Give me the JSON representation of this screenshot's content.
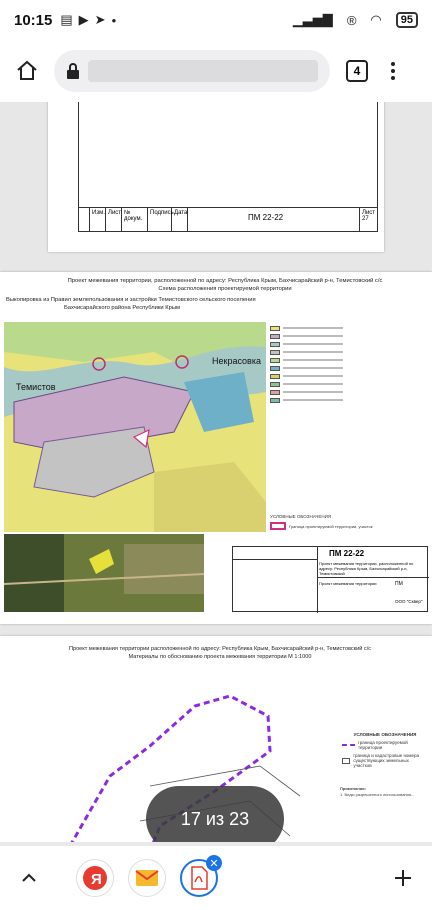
{
  "status_bar": {
    "time": "10:15",
    "battery": "95"
  },
  "toolbar": {
    "tab_count": "4"
  },
  "pdf": {
    "page1": {
      "code": "ПМ 22-22",
      "stamp_labels": [
        "Изм.",
        "Лист",
        "№ докум.",
        "Подпись",
        "Дата"
      ],
      "sheet_label": "Лист",
      "sheet_no": "27"
    },
    "page2": {
      "title": "Проект межевания территории, расположенной по адресу: Республика Крым, Бахчисарайский р-н, Темистовский с/с",
      "subtitle": "Схема расположения проектируемой территории",
      "extract": "Выкопировка из Правил землепользования и застройки Темистовского сельского поселения",
      "extract2": "Бахчисарайского района Республики Крым",
      "map_labels": [
        "Темистов",
        "Некрасовка"
      ],
      "legend_title": "УСЛОВНЫЕ ОБОЗНАЧЕНИЯ",
      "legend_item": "Граница проектируемой территории, участок",
      "stamp_code": "ПМ 22-22",
      "stamp_text": "Проект межевания территории, расположенной по адресу: Республика Крым, Бахчисарайский р-н, Темистовский",
      "stamp_sheet": "Проект межевания территории",
      "stamp_stage": "ПМ",
      "stamp_company": "ООО \"Сквер\""
    },
    "page3": {
      "title": "Проект межевания территории расположенной по адресу: Республика Крым, Бахчисарайский р-н, Темистовский с/с",
      "subtitle": "Материалы по обоснованию проекта межевания территории М 1:1000",
      "legend_title": "УСЛОВНЫЕ ОБОЗНАЧЕНИЯ",
      "legend1": "граница проектируемой территории",
      "legend2": "граница и кадастровые номера существующих земельных участков",
      "notes_title": "Примечания:",
      "notes": "1. Виды разрешенного использования..."
    },
    "page_indicator": "17 из 23"
  },
  "colors": {
    "accent": "#1a73e8",
    "boundary": "#8a2be2",
    "counter_bg": "#3c3c3c"
  }
}
